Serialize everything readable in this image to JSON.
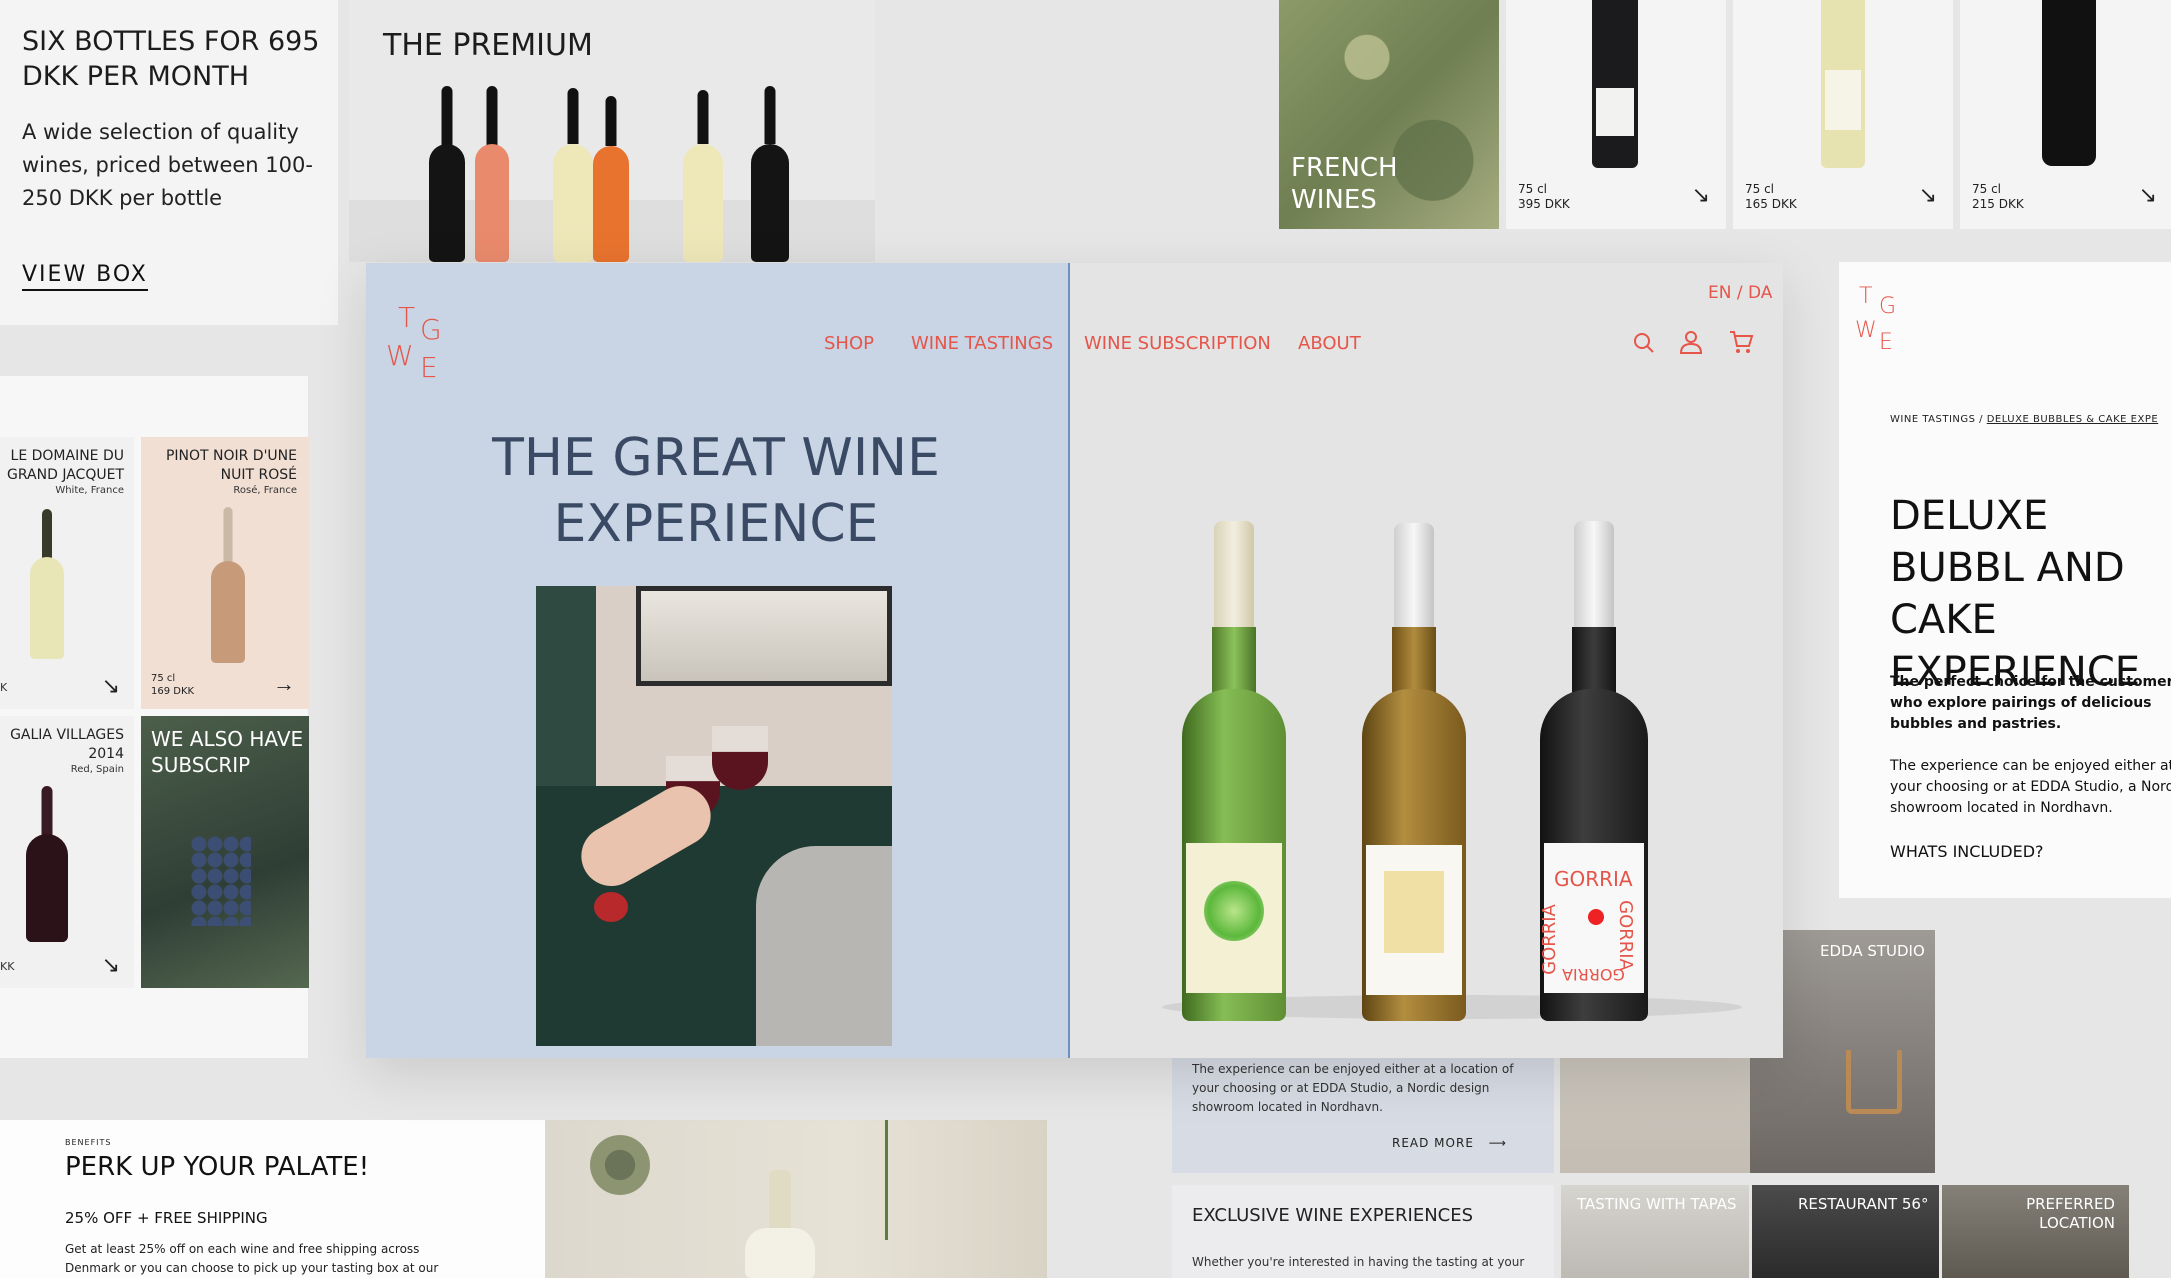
{
  "subscription_card": {
    "title": "SIX BOTTLES FOR 695 DKK PER MONTH",
    "text": "A wide selection of quality wines, priced between 100-250 DKK per bottle",
    "link": "VIEW BOX"
  },
  "premium_card": {
    "title": "THE PREMIUM"
  },
  "french_wines": {
    "label": "FRENCH WINES",
    "products": [
      {
        "volume": "75 cl",
        "price": "395 DKK"
      },
      {
        "volume": "75 cl",
        "price": "165 DKK"
      },
      {
        "volume": "75 cl",
        "price": "215 DKK"
      }
    ]
  },
  "product_grid": {
    "items": [
      {
        "name": "LE DOMAINE DU GRAND JACQUET",
        "sub": "White, France",
        "volume": "",
        "price": ""
      },
      {
        "name": "PINOT NOIR D'UNE NUIT ROSÉ",
        "sub": "Rosé, France",
        "volume": "75 cl",
        "price": "169 DKK"
      },
      {
        "name": "GALIA VILLAGES 2014",
        "sub": "Red, Spain",
        "volume": "",
        "price": ""
      }
    ],
    "subscription_promo": "WE ALSO HAVE WINE SUBSCRIP",
    "frag_k1": "K",
    "frag_k2": "KK"
  },
  "main": {
    "logo": {
      "t": "T",
      "g": "G",
      "w": "W",
      "e": "E"
    },
    "nav": [
      "SHOP",
      "WINE TASTINGS",
      "WINE SUBSCRIPTION",
      "ABOUT"
    ],
    "lang": "EN / DA",
    "headline": "THE GREAT WINE EXPERIENCE",
    "bottle_labels": [
      "GORRIA",
      "GORRIA",
      "GORRIA",
      "GORRIA"
    ]
  },
  "detail_page": {
    "breadcrumb_root": "WINE TASTINGS /",
    "breadcrumb_current": "DELUXE BUBBLES & CAKE EXPE",
    "title": "DELUXE BUBBL AND CAKE EXPERIENCE",
    "p1": "The perfect choice for the customer who explore pairings of delicious bubbles and pastries.",
    "p2": "The experience can be enjoyed either at your choosing or at EDDA Studio, a Nordi showroom located in Nordhavn.",
    "included": "WHATS INCLUDED?"
  },
  "experiences": {
    "desc": "The experience can be enjoyed either at a location of your choosing or at EDDA Studio, a Nordic design showroom located in Nordhavn.",
    "read_more": "READ MORE",
    "edda": "EDDA STUDIO",
    "exclusive_title": "EXCLUSIVE WINE EXPERIENCES",
    "exclusive_text": "Whether you're interested in having the tasting at your",
    "tiles": [
      "TASTING WITH TAPAS",
      "RESTAURANT 56°",
      "PREFERRED LOCATION"
    ]
  },
  "benefits": {
    "eyebrow": "BENEFITS",
    "title": "PERK UP YOUR PALATE!",
    "offer": "25% OFF + FREE SHIPPING",
    "text": "Get at least 25% off on each wine and free shipping across Denmark or you can choose to pick up your tasting box at our"
  },
  "colors": {
    "coral": "#e5554a",
    "navy": "#3a4a64",
    "blue_panel": "#c9d5e4"
  }
}
